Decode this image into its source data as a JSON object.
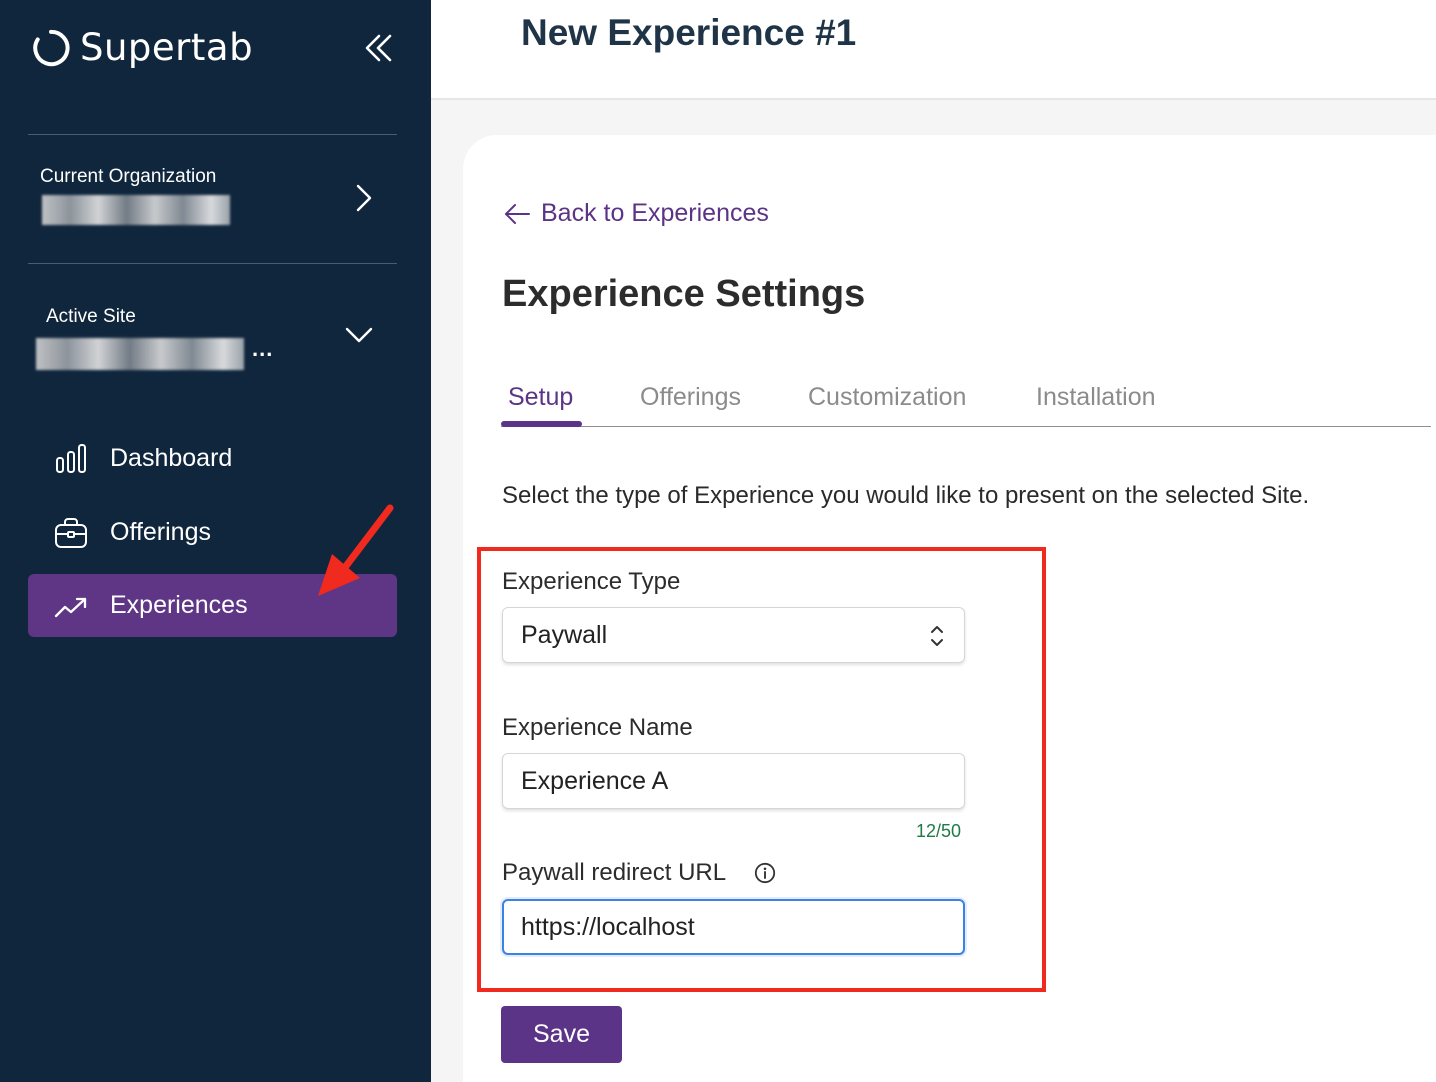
{
  "sidebar": {
    "brand": "Supertab",
    "current_org_label": "Current Organization",
    "active_site_label": "Active Site",
    "active_site_ellipsis": "...",
    "nav": [
      {
        "label": "Dashboard",
        "icon": "bar-chart-icon",
        "active": false
      },
      {
        "label": "Offerings",
        "icon": "briefcase-icon",
        "active": false
      },
      {
        "label": "Experiences",
        "icon": "trending-up-icon",
        "active": true
      }
    ]
  },
  "header": {
    "title": "New Experience #1"
  },
  "main": {
    "back_link": "Back to Experiences",
    "section_title": "Experience Settings",
    "tabs": [
      {
        "label": "Setup",
        "active": true
      },
      {
        "label": "Offerings",
        "active": false
      },
      {
        "label": "Customization",
        "active": false
      },
      {
        "label": "Installation",
        "active": false
      }
    ],
    "intro": "Select the type of Experience you would like to present on the selected Site.",
    "form": {
      "type_label": "Experience Type",
      "type_value": "Paywall",
      "name_label": "Experience Name",
      "name_value": "Experience A",
      "name_count": "12/50",
      "url_label": "Paywall redirect URL",
      "url_value": "https://localhost"
    },
    "save_label": "Save"
  },
  "colors": {
    "sidebar_bg": "#10263d",
    "accent_purple": "#5c3487",
    "annotation_red": "#f02a1e",
    "focus_blue": "#3b82e6"
  }
}
